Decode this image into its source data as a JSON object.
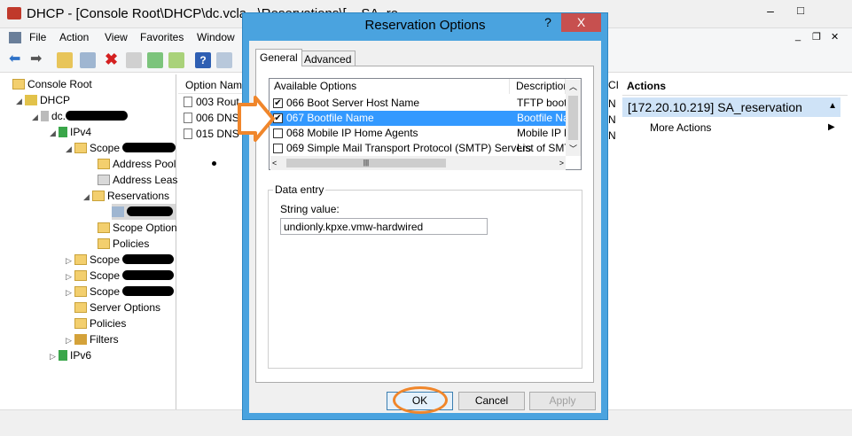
{
  "window": {
    "title": "DHCP - [Console Root\\DHCP\\dc.vcla...\\Reservations\\[... SA_re..."
  },
  "menu": [
    "File",
    "Action",
    "View",
    "Favorites",
    "Window"
  ],
  "tree": {
    "console_root": "Console Root",
    "dhcp": "DHCP",
    "server": "dc.",
    "ipv4": "IPv4",
    "scope": "Scope",
    "address_pool": "Address Pool",
    "address_leases": "Address Leas",
    "reservations": "Reservations",
    "scope_options": "Scope Option",
    "policies": "Policies",
    "scope2": "Scope",
    "scope3": "Scope",
    "scope4": "Scope",
    "server_options": "Server Options",
    "policies2": "Policies",
    "filters": "Filters",
    "ipv6": "IPv6"
  },
  "middle": {
    "header": "Option Nam",
    "rows": [
      "003 Rout",
      "006 DNS",
      "015 DNS"
    ],
    "right_header": "CI",
    "right_cells": [
      "N",
      "N",
      "N"
    ]
  },
  "actions": {
    "header": "Actions",
    "selected": "[172.20.10.219] SA_reservation",
    "more": "More Actions"
  },
  "dialog": {
    "title": "Reservation Options",
    "help": "?",
    "close": "X",
    "tabs": [
      "General",
      "Advanced"
    ],
    "options_header": "Available Options",
    "description_header": "Description",
    "options": [
      {
        "name": "066 Boot Server Host Name",
        "desc": "TFTP boot s",
        "checked": true
      },
      {
        "name": "067 Bootfile Name",
        "desc": "Bootfile Nan",
        "checked": true
      },
      {
        "name": "068 Mobile IP Home Agents",
        "desc": "Mobile IP ho",
        "checked": false
      },
      {
        "name": "069 Simple Mail Transport Protocol (SMTP) Servers",
        "desc": "List of SMTI",
        "checked": false
      }
    ],
    "data_entry_label": "Data entry",
    "string_value_label": "String value:",
    "string_value": "undionly.kpxe.vmw-hardwired",
    "ok": "OK",
    "cancel": "Cancel",
    "apply": "Apply"
  },
  "colors": {
    "accent": "#4aa3df",
    "highlight_arrow": "#f0862b",
    "selection": "#3399ff"
  }
}
